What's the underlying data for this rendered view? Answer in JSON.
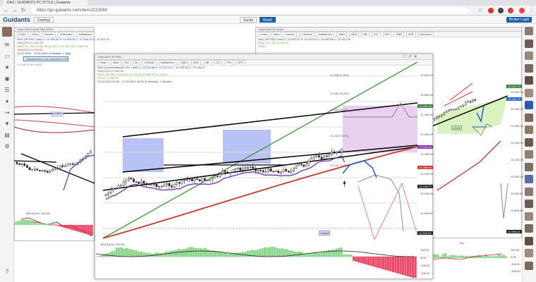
{
  "browser": {
    "tab_title": "DAX / GUIDANTS PC STYLE | Guidants",
    "url": "https://go.guidants.com/de#c2233069"
  },
  "app": {
    "logo": "Guidants",
    "desktop_label": "Desktop",
    "search_label": "Suche",
    "markt_label": "Markt",
    "login_label": "Broker Login"
  },
  "left_panel": {
    "title": "Chart DAX Fut 5ETRA FREE",
    "tools": [
      "Chart",
      "Wert",
      "Kerzen",
      "5 Minuten",
      "Indikatoren"
    ],
    "legend_line1": "DAX (XETRA, Last) O: 12.345,32 H: 12.405,87 L: 12.344,23 C: 12.412,78",
    "legend_line2": "SMA(200) 12.264,20",
    "legend_line3": "MA(8, 21, 25) 12.392,06 12.387,74 12.387,59 12.387,08",
    "legend_line4": "SMA(200) 11.903,59",
    "date_range": "14.01.2019 - 22.05.2019 (4 Monate, 1 Tag)",
    "badge": "Abwarteband vom Allzeithoch!!!!!!!",
    "note": "12.328,54 (61,80%)",
    "macd_label": "MACD(14) -234,36",
    "level_label": "11803"
  },
  "main_panel": {
    "title": "Chart DAX 30 PRO",
    "tools": [
      "Chart",
      "Wert",
      "5d",
      "5h",
      "1 Monat",
      "Indikatoren",
      "SMA",
      "ADX",
      "BB",
      "CCI",
      "RSI",
      "ATR"
    ],
    "legend_line1": "DAX (Commerzbank CFD, Last) O: 12.216,68 H: 12.247,22 L: 12.182,36 C: 12.198,07",
    "legend_line2": "SMA(200) 12.285,84",
    "legend_line3": "MA(8, 20, 25) 12.316,28 12.318,26 12.316,09 12.316,07",
    "legend_line4": "PP(D) 12.589,64",
    "legend_line5": "23.04.2019 20:00 - 07.05.2019 18:00 (2 Wochen, 1 Stunde)",
    "macd_label": "MACD(14) -234,36",
    "level_notes": [
      "12.556,57 (R2)",
      "12.480,46 (R1)",
      "12.358,05 (P)",
      "12.253,03 (S1)",
      "12.192,71 (S2)"
    ],
    "tag_label": "Verlauf",
    "y_labels": [
      "12.600,00",
      "12.500,00",
      "12.400,00",
      "12.300,00",
      "12.200,00",
      "12.100,00",
      "12.000,00",
      "11.900,00"
    ],
    "price_tags": [
      "12.393,48",
      "12.318,09",
      "12.285,84",
      "12.198,07",
      "11.906,00"
    ],
    "macd_labels": [
      "100,00",
      "0,00",
      "-100,00",
      "-200,00"
    ]
  },
  "right_panel": {
    "title": "Chart DAX 30 Xetra",
    "tools": [
      "Chart",
      "Wert",
      "Kerzen",
      "1 Woche",
      "Indikatoren",
      "SMA",
      "ADX",
      "BB",
      "CCI",
      "RSI",
      "SMA",
      "ATR",
      "Zeichnen"
    ],
    "legend_line1": "DAX (XETRA, Last) O: 12.092,97 H: 12.432,41 L: 12.092,08 C: 12.412,78",
    "legend_line2": "MA(8, 20, 25) 12.234,21",
    "legend_line3": "PP(D)",
    "y_labels": [
      "12.500,00",
      "12.400,00",
      "12.300,00",
      "12.200,00",
      "12.100,00",
      "12.000,00",
      "11.900,00",
      "11.800,00"
    ],
    "price_tags": [
      "12.412,78",
      "12.356,76",
      "11.986,24"
    ],
    "macd_labels": [
      "100,00",
      "0,00",
      "-100,00",
      "-200,00"
    ],
    "x_label": "Mai"
  },
  "colors": {
    "accent": "#1a5ea8",
    "up": "#1a7a1a",
    "down": "#cc2222",
    "band_blue": "#9aa8f0",
    "band_purple": "#e5c8ef"
  }
}
